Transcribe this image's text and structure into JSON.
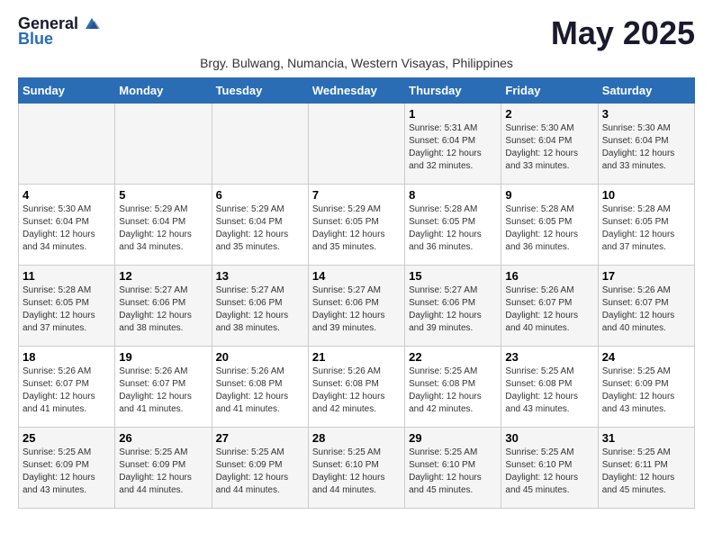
{
  "logo": {
    "general": "General",
    "blue": "Blue"
  },
  "title": "May 2025",
  "subtitle": "Brgy. Bulwang, Numancia, Western Visayas, Philippines",
  "header_days": [
    "Sunday",
    "Monday",
    "Tuesday",
    "Wednesday",
    "Thursday",
    "Friday",
    "Saturday"
  ],
  "weeks": [
    [
      {
        "day": "",
        "info": ""
      },
      {
        "day": "",
        "info": ""
      },
      {
        "day": "",
        "info": ""
      },
      {
        "day": "",
        "info": ""
      },
      {
        "day": "1",
        "sunrise": "5:31 AM",
        "sunset": "6:04 PM",
        "daylight": "12 hours and 32 minutes."
      },
      {
        "day": "2",
        "sunrise": "5:30 AM",
        "sunset": "6:04 PM",
        "daylight": "12 hours and 33 minutes."
      },
      {
        "day": "3",
        "sunrise": "5:30 AM",
        "sunset": "6:04 PM",
        "daylight": "12 hours and 33 minutes."
      }
    ],
    [
      {
        "day": "4",
        "sunrise": "5:30 AM",
        "sunset": "6:04 PM",
        "daylight": "12 hours and 34 minutes."
      },
      {
        "day": "5",
        "sunrise": "5:29 AM",
        "sunset": "6:04 PM",
        "daylight": "12 hours and 34 minutes."
      },
      {
        "day": "6",
        "sunrise": "5:29 AM",
        "sunset": "6:04 PM",
        "daylight": "12 hours and 35 minutes."
      },
      {
        "day": "7",
        "sunrise": "5:29 AM",
        "sunset": "6:05 PM",
        "daylight": "12 hours and 35 minutes."
      },
      {
        "day": "8",
        "sunrise": "5:28 AM",
        "sunset": "6:05 PM",
        "daylight": "12 hours and 36 minutes."
      },
      {
        "day": "9",
        "sunrise": "5:28 AM",
        "sunset": "6:05 PM",
        "daylight": "12 hours and 36 minutes."
      },
      {
        "day": "10",
        "sunrise": "5:28 AM",
        "sunset": "6:05 PM",
        "daylight": "12 hours and 37 minutes."
      }
    ],
    [
      {
        "day": "11",
        "sunrise": "5:28 AM",
        "sunset": "6:05 PM",
        "daylight": "12 hours and 37 minutes."
      },
      {
        "day": "12",
        "sunrise": "5:27 AM",
        "sunset": "6:06 PM",
        "daylight": "12 hours and 38 minutes."
      },
      {
        "day": "13",
        "sunrise": "5:27 AM",
        "sunset": "6:06 PM",
        "daylight": "12 hours and 38 minutes."
      },
      {
        "day": "14",
        "sunrise": "5:27 AM",
        "sunset": "6:06 PM",
        "daylight": "12 hours and 39 minutes."
      },
      {
        "day": "15",
        "sunrise": "5:27 AM",
        "sunset": "6:06 PM",
        "daylight": "12 hours and 39 minutes."
      },
      {
        "day": "16",
        "sunrise": "5:26 AM",
        "sunset": "6:07 PM",
        "daylight": "12 hours and 40 minutes."
      },
      {
        "day": "17",
        "sunrise": "5:26 AM",
        "sunset": "6:07 PM",
        "daylight": "12 hours and 40 minutes."
      }
    ],
    [
      {
        "day": "18",
        "sunrise": "5:26 AM",
        "sunset": "6:07 PM",
        "daylight": "12 hours and 41 minutes."
      },
      {
        "day": "19",
        "sunrise": "5:26 AM",
        "sunset": "6:07 PM",
        "daylight": "12 hours and 41 minutes."
      },
      {
        "day": "20",
        "sunrise": "5:26 AM",
        "sunset": "6:08 PM",
        "daylight": "12 hours and 41 minutes."
      },
      {
        "day": "21",
        "sunrise": "5:26 AM",
        "sunset": "6:08 PM",
        "daylight": "12 hours and 42 minutes."
      },
      {
        "day": "22",
        "sunrise": "5:25 AM",
        "sunset": "6:08 PM",
        "daylight": "12 hours and 42 minutes."
      },
      {
        "day": "23",
        "sunrise": "5:25 AM",
        "sunset": "6:08 PM",
        "daylight": "12 hours and 43 minutes."
      },
      {
        "day": "24",
        "sunrise": "5:25 AM",
        "sunset": "6:09 PM",
        "daylight": "12 hours and 43 minutes."
      }
    ],
    [
      {
        "day": "25",
        "sunrise": "5:25 AM",
        "sunset": "6:09 PM",
        "daylight": "12 hours and 43 minutes."
      },
      {
        "day": "26",
        "sunrise": "5:25 AM",
        "sunset": "6:09 PM",
        "daylight": "12 hours and 44 minutes."
      },
      {
        "day": "27",
        "sunrise": "5:25 AM",
        "sunset": "6:09 PM",
        "daylight": "12 hours and 44 minutes."
      },
      {
        "day": "28",
        "sunrise": "5:25 AM",
        "sunset": "6:10 PM",
        "daylight": "12 hours and 44 minutes."
      },
      {
        "day": "29",
        "sunrise": "5:25 AM",
        "sunset": "6:10 PM",
        "daylight": "12 hours and 45 minutes."
      },
      {
        "day": "30",
        "sunrise": "5:25 AM",
        "sunset": "6:10 PM",
        "daylight": "12 hours and 45 minutes."
      },
      {
        "day": "31",
        "sunrise": "5:25 AM",
        "sunset": "6:11 PM",
        "daylight": "12 hours and 45 minutes."
      }
    ]
  ],
  "labels": {
    "sunrise": "Sunrise:",
    "sunset": "Sunset:",
    "daylight": "Daylight:"
  }
}
